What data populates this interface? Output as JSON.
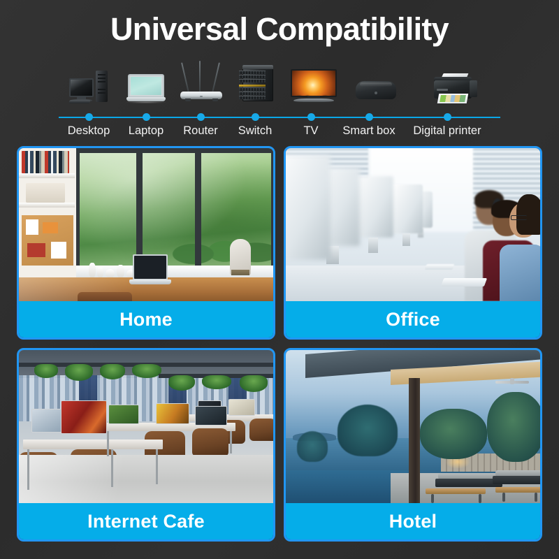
{
  "header": {
    "title": "Universal Compatibility"
  },
  "compatibility": {
    "devices": [
      {
        "label": "Desktop",
        "icon": "desktop-computer-icon"
      },
      {
        "label": "Laptop",
        "icon": "laptop-icon"
      },
      {
        "label": "Router",
        "icon": "wifi-router-icon"
      },
      {
        "label": "Switch",
        "icon": "network-switch-icon"
      },
      {
        "label": "TV",
        "icon": "television-icon"
      },
      {
        "label": "Smart box",
        "icon": "smart-tv-box-icon"
      },
      {
        "label": "Digital printer",
        "icon": "printer-icon"
      }
    ],
    "timeline_dot_color": "#18a9e8",
    "timeline_line_color": "#0aa7e8"
  },
  "scenarios": [
    {
      "caption": "Home",
      "scene": "home-office-desk-with-laptop-by-window"
    },
    {
      "caption": "Office",
      "scene": "open-office-row-of-monitors-with-workers"
    },
    {
      "caption": "Internet Cafe",
      "scene": "internet-cafe-gaming-desks-with-monitors"
    },
    {
      "caption": "Hotel",
      "scene": "hotel-resort-terrace-with-infinity-pool"
    }
  ],
  "colors": {
    "background": "#2e2e2e",
    "accent_cyan": "#05ade9",
    "card_border_blue": "#2196f3",
    "title_text": "#ffffff",
    "label_text": "#f2f2f2"
  }
}
